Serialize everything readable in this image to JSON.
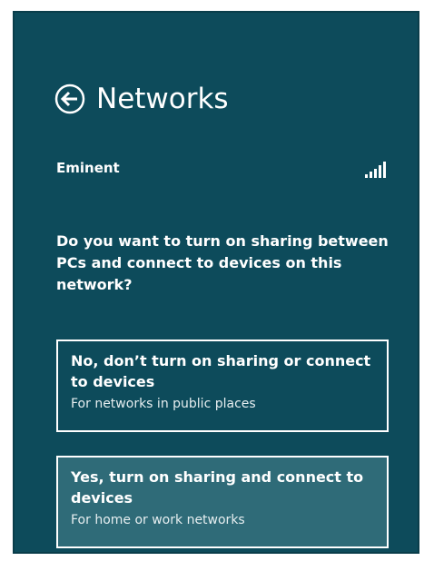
{
  "header": {
    "title": "Networks",
    "back_icon": "arrow-left-circle-icon"
  },
  "network": {
    "name": "Eminent",
    "signal_icon": "signal-strength-icon",
    "signal_bars_filled": 5
  },
  "prompt": {
    "question": "Do you want to turn on sharing between PCs and connect to devices on this network?"
  },
  "options": [
    {
      "title": "No, don’t turn on sharing or connect to devices",
      "subtitle": "For networks in public places"
    },
    {
      "title": "Yes, turn on sharing and connect to devices",
      "subtitle": "For home or work networks"
    }
  ],
  "colors": {
    "panel_background": "#0d4b5b",
    "highlight_option": "#2f6b78",
    "text": "#ffffff"
  }
}
